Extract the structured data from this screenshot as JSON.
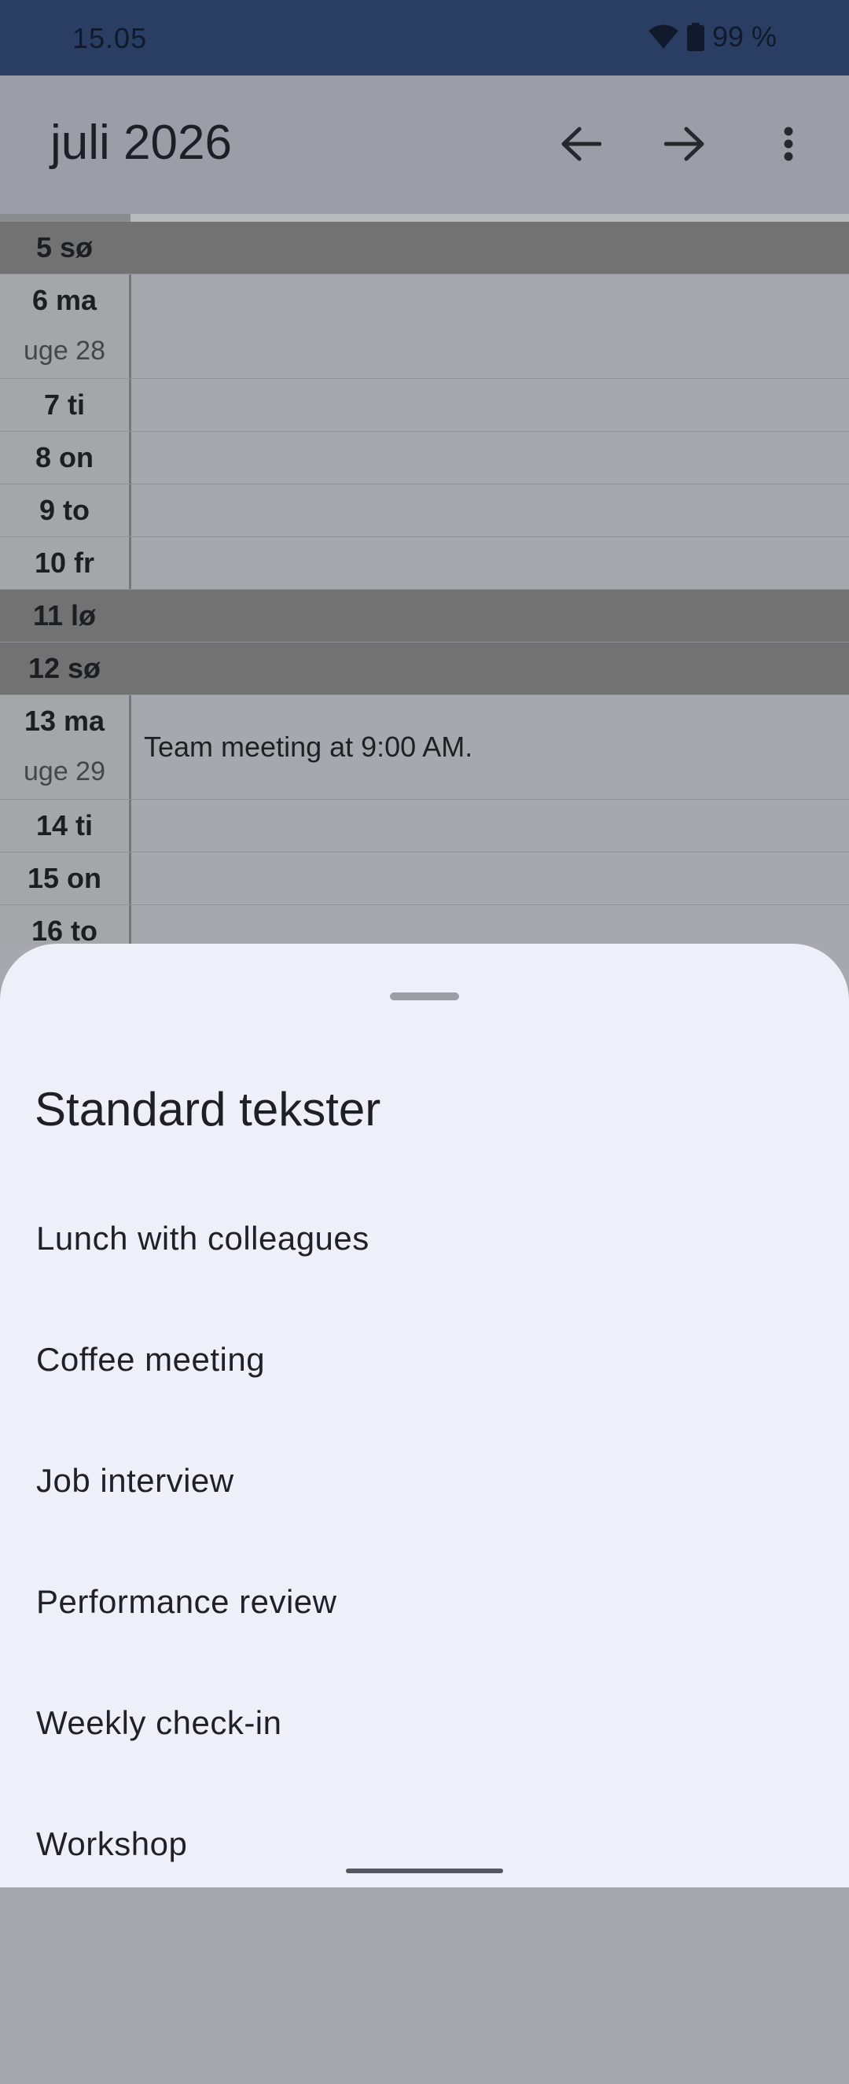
{
  "status_bar": {
    "time": "15.05",
    "battery": "99 %",
    "icons": [
      "wifi-icon",
      "battery-icon"
    ]
  },
  "app_bar": {
    "title": "juli 2026",
    "actions": [
      "arrow-back-icon",
      "arrow-forward-icon",
      "more-vert-icon"
    ]
  },
  "calendar": {
    "rows": [
      {
        "day": "5 sø",
        "weekend": true,
        "week": "",
        "event": ""
      },
      {
        "day": "6 ma",
        "weekend": false,
        "week": "uge 28",
        "event": ""
      },
      {
        "day": "7 ti",
        "weekend": false,
        "week": "",
        "event": ""
      },
      {
        "day": "8 on",
        "weekend": false,
        "week": "",
        "event": ""
      },
      {
        "day": "9 to",
        "weekend": false,
        "week": "",
        "event": ""
      },
      {
        "day": "10 fr",
        "weekend": false,
        "week": "",
        "event": ""
      },
      {
        "day": "11 lø",
        "weekend": true,
        "week": "",
        "event": ""
      },
      {
        "day": "12 sø",
        "weekend": true,
        "week": "",
        "event": ""
      },
      {
        "day": "13 ma",
        "weekend": false,
        "week": "uge 29",
        "event": "Team meeting at 9:00 AM."
      },
      {
        "day": "14 ti",
        "weekend": false,
        "week": "",
        "event": ""
      },
      {
        "day": "15 on",
        "weekend": false,
        "week": "",
        "event": ""
      },
      {
        "day": "16 to",
        "weekend": false,
        "week": "",
        "event": ""
      }
    ]
  },
  "sheet": {
    "title": "Standard tekster",
    "items": [
      "Lunch with colleagues",
      "Coffee meeting",
      "Job interview",
      "Performance review",
      "Weekly check-in",
      "Workshop"
    ]
  },
  "colors": {
    "status_bar": "#2a3d63",
    "sheet_bg": "#edf0f9",
    "scrim": "#a7a8ad",
    "weekend": "#727272"
  }
}
